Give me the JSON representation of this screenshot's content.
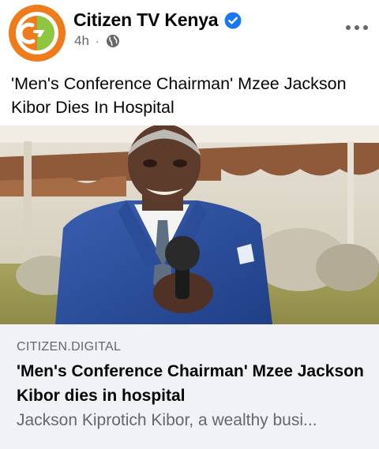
{
  "post": {
    "page_name": "Citizen TV Kenya",
    "time": "4h",
    "separator": "·",
    "text": "'Men's Conference Chairman' Mzee Jackson Kibor Dies In Hospital",
    "icons": {
      "avatar": "citizen-logo-icon",
      "verified": "verified-badge-icon",
      "privacy": "globe-icon",
      "menu": "more-options-icon"
    }
  },
  "link": {
    "domain": "CITIZEN.DIGITAL",
    "title": "'Men's Conference Chairman' Mzee Jackson Kibor dies in hospital",
    "description": "Jackson Kiprotich Kibor, a wealthy busi..."
  },
  "colors": {
    "verified_blue": "#1877f2",
    "logo_orange": "#f07b1a",
    "logo_green": "#8dc63f",
    "secondary_text": "#65676b",
    "link_bg": "#f0f2f5"
  }
}
